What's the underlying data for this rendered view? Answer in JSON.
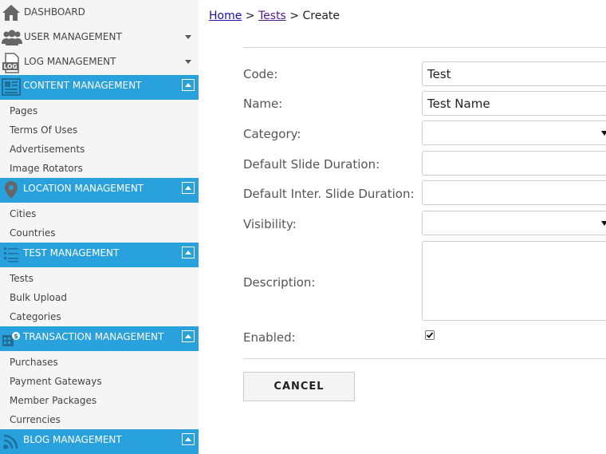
{
  "sidebar": {
    "top_items": [
      {
        "label": "DASHBOARD",
        "icon": "home-icon"
      },
      {
        "label": "USER MANAGEMENT",
        "icon": "users-icon"
      },
      {
        "label": "LOG MANAGEMENT",
        "icon": "log-icon",
        "icon_text": "LOG"
      }
    ],
    "sections": [
      {
        "label": "CONTENT MANAGEMENT",
        "icon": "content-icon",
        "items": [
          "Pages",
          "Terms Of Uses",
          "Advertisements",
          "Image Rotators"
        ]
      },
      {
        "label": "LOCATION MANAGEMENT",
        "icon": "location-pin-icon",
        "items": [
          "Cities",
          "Countries"
        ]
      },
      {
        "label": "TEST MANAGEMENT",
        "icon": "checklist-icon",
        "items": [
          "Tests",
          "Bulk Upload",
          "Categories"
        ]
      },
      {
        "label": "TRANSACTION MANAGEMENT",
        "icon": "transaction-icon",
        "items": [
          "Purchases",
          "Payment Gateways",
          "Member Packages",
          "Currencies"
        ]
      },
      {
        "label": "BLOG MANAGEMENT",
        "icon": "blog-icon",
        "items": []
      }
    ],
    "accent_color": "#29a1dc"
  },
  "breadcrumb": {
    "home": "Home",
    "sep1": ">",
    "tests": "Tests",
    "sep2": ">",
    "current": "Create"
  },
  "form": {
    "code_label": "Code:",
    "code_value": "Test",
    "name_label": "Name:",
    "name_value": "Test Name",
    "category_label": "Category:",
    "category_value": "",
    "slide_duration_label": "Default Slide Duration:",
    "slide_duration_value": "",
    "inter_slide_label": "Default Inter. Slide Duration:",
    "inter_slide_value": "",
    "visibility_label": "Visibility:",
    "visibility_value": "",
    "description_label": "Description:",
    "description_value": "",
    "enabled_label": "Enabled:",
    "enabled_checked": true,
    "cancel_label": "CANCEL"
  }
}
